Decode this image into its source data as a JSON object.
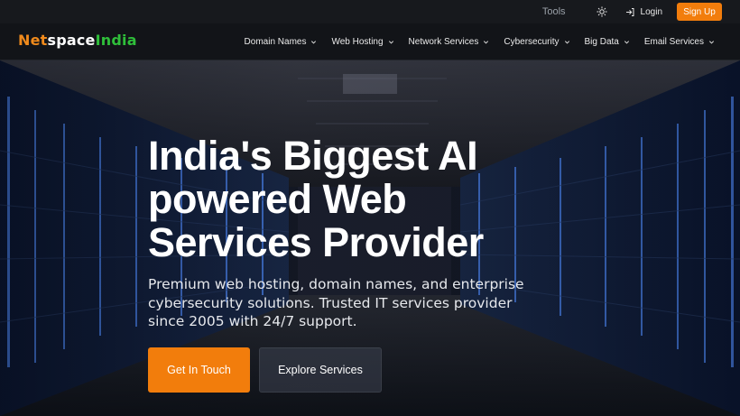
{
  "topbar": {
    "tools_label": "Tools",
    "theme_icon": "sun-icon",
    "login_icon": "login-arrow-icon",
    "login_label": "Login",
    "signup_label": "Sign Up"
  },
  "brand": {
    "part1": "Net",
    "part2": "space",
    "part3": "India",
    "colors": {
      "net": "#f08a1c",
      "space": "#ffffff",
      "india": "#2fbf3a"
    }
  },
  "nav": {
    "items": [
      {
        "label": "Domain Names"
      },
      {
        "label": "Web Hosting"
      },
      {
        "label": "Network Services"
      },
      {
        "label": "Cybersecurity"
      },
      {
        "label": "Big Data"
      },
      {
        "label": "Email Services"
      }
    ]
  },
  "hero": {
    "headline": "India's Biggest AI powered Web Services Provider",
    "subtitle": "Premium web hosting, domain names, and enterprise cybersecurity solutions. Trusted IT services provider since 2005 with 24/7 support.",
    "primary_cta": "Get In Touch",
    "secondary_cta": "Explore Services"
  },
  "colors": {
    "accent": "#f27d0c",
    "topbar_bg": "#17191d",
    "nav_bg": "#121418"
  }
}
